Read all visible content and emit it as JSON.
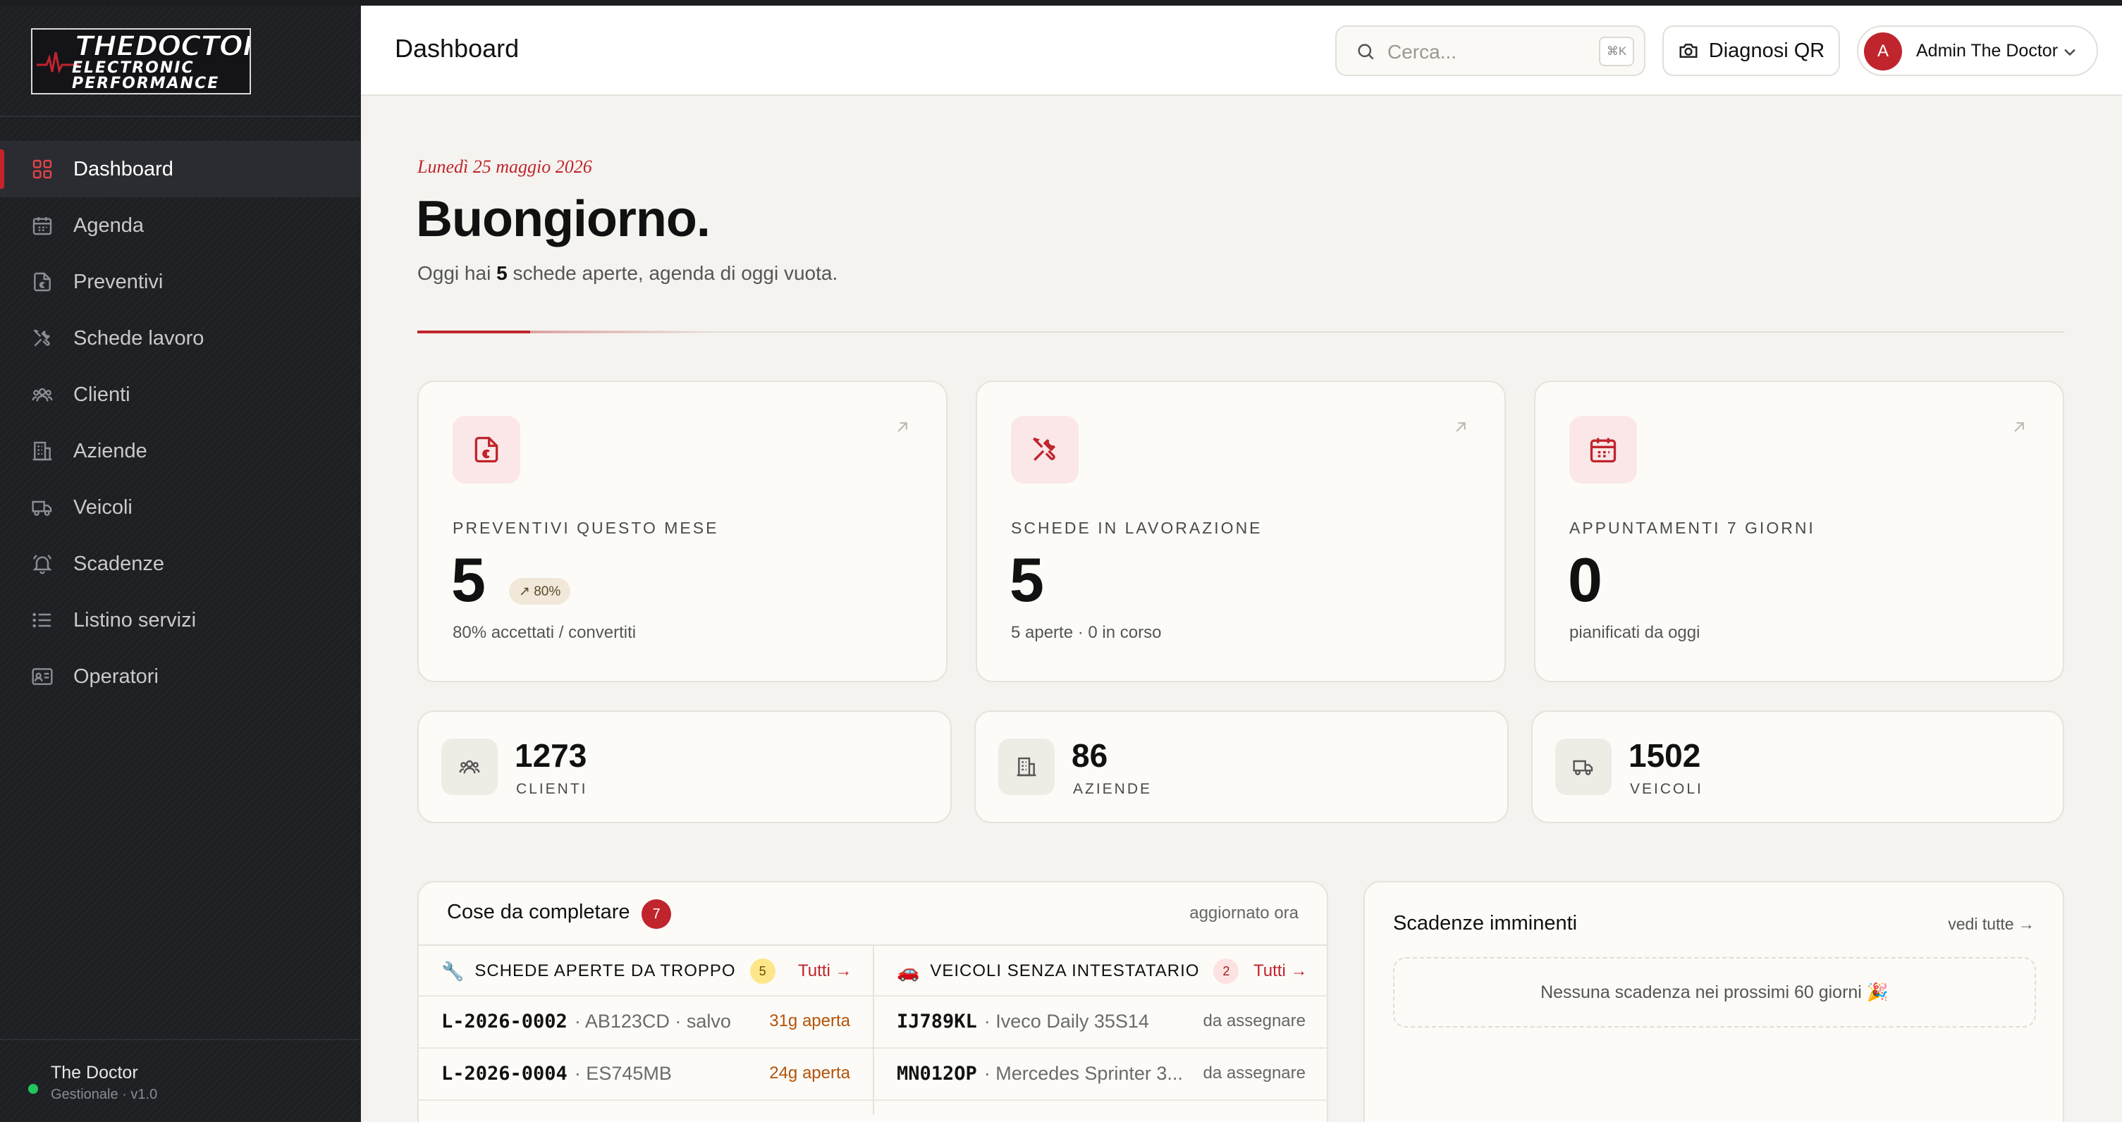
{
  "colors": {
    "accent": "#c0242d",
    "sidebar": "#1e1f23",
    "background": "#f5f3ef",
    "card": "#fcfbf8",
    "online": "#22c55e"
  },
  "brand": {
    "logo_line1": "THEDOCTOR",
    "logo_line2": "ELECTRONIC",
    "logo_line3": "PERFORMANCE"
  },
  "sidebar": {
    "items": [
      {
        "label": "Dashboard",
        "icon": "grid-icon",
        "active": true
      },
      {
        "label": "Agenda",
        "icon": "calendar-icon"
      },
      {
        "label": "Preventivi",
        "icon": "file-euro-icon"
      },
      {
        "label": "Schede lavoro",
        "icon": "tools-icon"
      },
      {
        "label": "Clienti",
        "icon": "users-icon"
      },
      {
        "label": "Aziende",
        "icon": "building-icon"
      },
      {
        "label": "Veicoli",
        "icon": "truck-icon"
      },
      {
        "label": "Scadenze",
        "icon": "bell-icon"
      },
      {
        "label": "Listino servizi",
        "icon": "list-icon"
      },
      {
        "label": "Operatori",
        "icon": "id-card-icon"
      }
    ],
    "footer": {
      "name": "The Doctor",
      "version": "Gestionale · v1.0"
    }
  },
  "header": {
    "title": "Dashboard",
    "search_placeholder": "Cerca...",
    "search_shortcut": "⌘K",
    "qr_label": "Diagnosi QR",
    "user_initial": "A",
    "user_name": "Admin The Doctor"
  },
  "hero": {
    "date": "Lunedì 25 maggio 2026",
    "greeting": "Buongiorno.",
    "summary_prefix": "Oggi hai",
    "summary_count": "5",
    "summary_suffix": "schede aperte, agenda di oggi vuota."
  },
  "kpis": [
    {
      "label": "PREVENTIVI QUESTO MESE",
      "value": "5",
      "badge": "↗ 80%",
      "sub": "80% accettati / convertiti",
      "icon": "file-euro-icon"
    },
    {
      "label": "SCHEDE IN LAVORAZIONE",
      "value": "5",
      "sub": "5 aperte · 0 in corso",
      "icon": "tools-icon"
    },
    {
      "label": "APPUNTAMENTI 7 GIORNI",
      "value": "0",
      "sub": "pianificati da oggi",
      "icon": "calendar-icon"
    }
  ],
  "stats": [
    {
      "value": "1273",
      "label": "CLIENTI",
      "icon": "users-icon"
    },
    {
      "value": "86",
      "label": "AZIENDE",
      "icon": "building-icon"
    },
    {
      "value": "1502",
      "label": "VEICOLI",
      "icon": "truck-icon"
    }
  ],
  "todo": {
    "title": "Cose da completare",
    "count": "7",
    "updated": "aggiornato ora",
    "left": {
      "emoji": "🔧",
      "title": "SCHEDE APERTE DA TROPPO",
      "count": "5",
      "link": "Tutti →",
      "rows": [
        {
          "code": "L-2026-0002",
          "detail": "· AB123CD · salvo",
          "tag": "31g aperta"
        },
        {
          "code": "L-2026-0004",
          "detail": "· ES745MB",
          "tag": "24g aperta"
        }
      ]
    },
    "right": {
      "emoji": "🚗",
      "title": "VEICOLI SENZA INTESTATARIO",
      "count": "2",
      "link": "Tutti →",
      "rows": [
        {
          "code": "IJ789KL",
          "detail": "· Iveco Daily 35S14",
          "tag": "da assegnare"
        },
        {
          "code": "MN012OP",
          "detail": "· Mercedes Sprinter 3...",
          "tag": "da assegnare"
        }
      ]
    }
  },
  "deadlines": {
    "title": "Scadenze imminenti",
    "link": "vedi tutte →",
    "empty": "Nessuna scadenza nei prossimi 60 giorni 🎉"
  }
}
